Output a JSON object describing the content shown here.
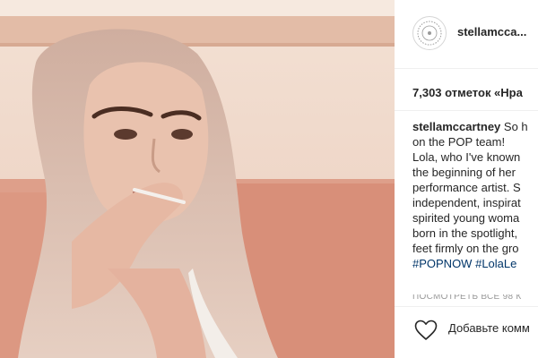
{
  "post": {
    "username": "stellamcca...",
    "likes_label": "7,303 отметок «Нра",
    "caption_user": "stellamccartney",
    "caption_lines": [
      " So h",
      "on the POP team!",
      "Lola, who I've known",
      "the beginning of her",
      "performance artist. S",
      "independent, inspirat",
      "spirited young woma",
      "born in the spotlight,",
      "feet firmly on the gro"
    ],
    "hashtags": [
      "#POPNOW",
      "#LolaLe"
    ],
    "timestamp": "ПОСМОТРЕТЬ ВСЕ 98 К",
    "add_comment_label": "Добавьте комм"
  },
  "icons": {
    "avatar": "stella-mccartney-logo-icon",
    "like": "heart-outline-icon"
  },
  "colors": {
    "text": "#262626",
    "hashtag": "#003569",
    "muted": "#999999",
    "divider": "#efefef",
    "photo_tone": "#e9bfae"
  }
}
